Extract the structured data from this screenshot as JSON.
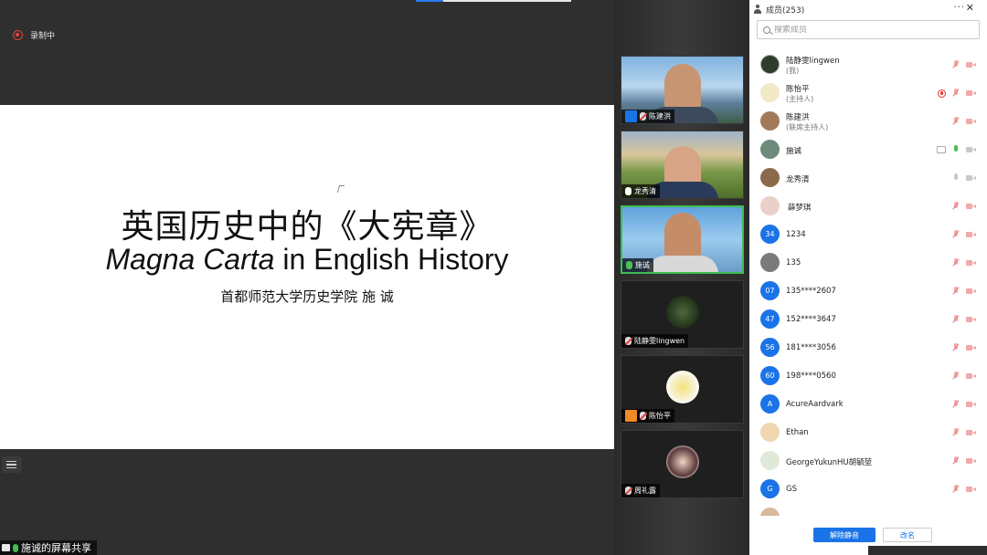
{
  "recording": {
    "label": "录制中"
  },
  "slide": {
    "title_cn": "英国历史中的《大宪章》",
    "title_en_italic": "Magna Carta",
    "title_en_rest": " in English History",
    "subtitle": "首都师范大学历史学院   施 诚"
  },
  "screen_share_label": "施诚的屏幕共享",
  "tiles": [
    {
      "name": "陈建洪"
    },
    {
      "name": "龙秀清"
    },
    {
      "name": "施诚"
    },
    {
      "name": "陆静雯lingwen"
    },
    {
      "name": "陈怡平"
    },
    {
      "name": "周礼露"
    }
  ],
  "panel": {
    "title": "成员(253)",
    "more": "···",
    "close": "✕",
    "search_placeholder": "搜索成员",
    "unmute_all": "解除静音",
    "rename": "改名"
  },
  "members": [
    {
      "name": "陆静雯lingwen",
      "role": "(我)",
      "avatar_text": "",
      "avatar_color": "#2f3b2f"
    },
    {
      "name": "陈怡平",
      "role": "(主持人)",
      "avatar_text": "",
      "avatar_color": "#f2e9c8"
    },
    {
      "name": "陈建洪",
      "role": "(联席主持人)",
      "avatar_text": "",
      "avatar_color": "#a27a5a"
    },
    {
      "name": "施诚",
      "role": "",
      "avatar_text": "",
      "avatar_color": "#6d8a7a"
    },
    {
      "name": "龙秀清",
      "role": "",
      "avatar_text": "",
      "avatar_color": "#8a6a4a"
    },
    {
      "name": "薛梦琪",
      "role": "",
      "avatar_text": "",
      "avatar_color": "#e9d0c9"
    },
    {
      "name": "1234",
      "role": "",
      "avatar_text": "34",
      "avatar_color": "#1b73e8"
    },
    {
      "name": "135",
      "role": "",
      "avatar_text": "",
      "avatar_color": "#7a7a7a"
    },
    {
      "name": "135****2607",
      "role": "",
      "avatar_text": "07",
      "avatar_color": "#1b73e8"
    },
    {
      "name": "152****3647",
      "role": "",
      "avatar_text": "47",
      "avatar_color": "#1b73e8"
    },
    {
      "name": "181****3056",
      "role": "",
      "avatar_text": "56",
      "avatar_color": "#1b73e8"
    },
    {
      "name": "198****0560",
      "role": "",
      "avatar_text": "60",
      "avatar_color": "#1b73e8"
    },
    {
      "name": "AcureAardvark",
      "role": "",
      "avatar_text": "A",
      "avatar_color": "#1b73e8"
    },
    {
      "name": "Ethan",
      "role": "",
      "avatar_text": "",
      "avatar_color": "#f0d7b0"
    },
    {
      "name": "GeorgeYukunHU胡毓堃",
      "role": "",
      "avatar_text": "",
      "avatar_color": "#dfe9d8"
    },
    {
      "name": "GS",
      "role": "",
      "avatar_text": "G",
      "avatar_color": "#1b73e8"
    }
  ]
}
